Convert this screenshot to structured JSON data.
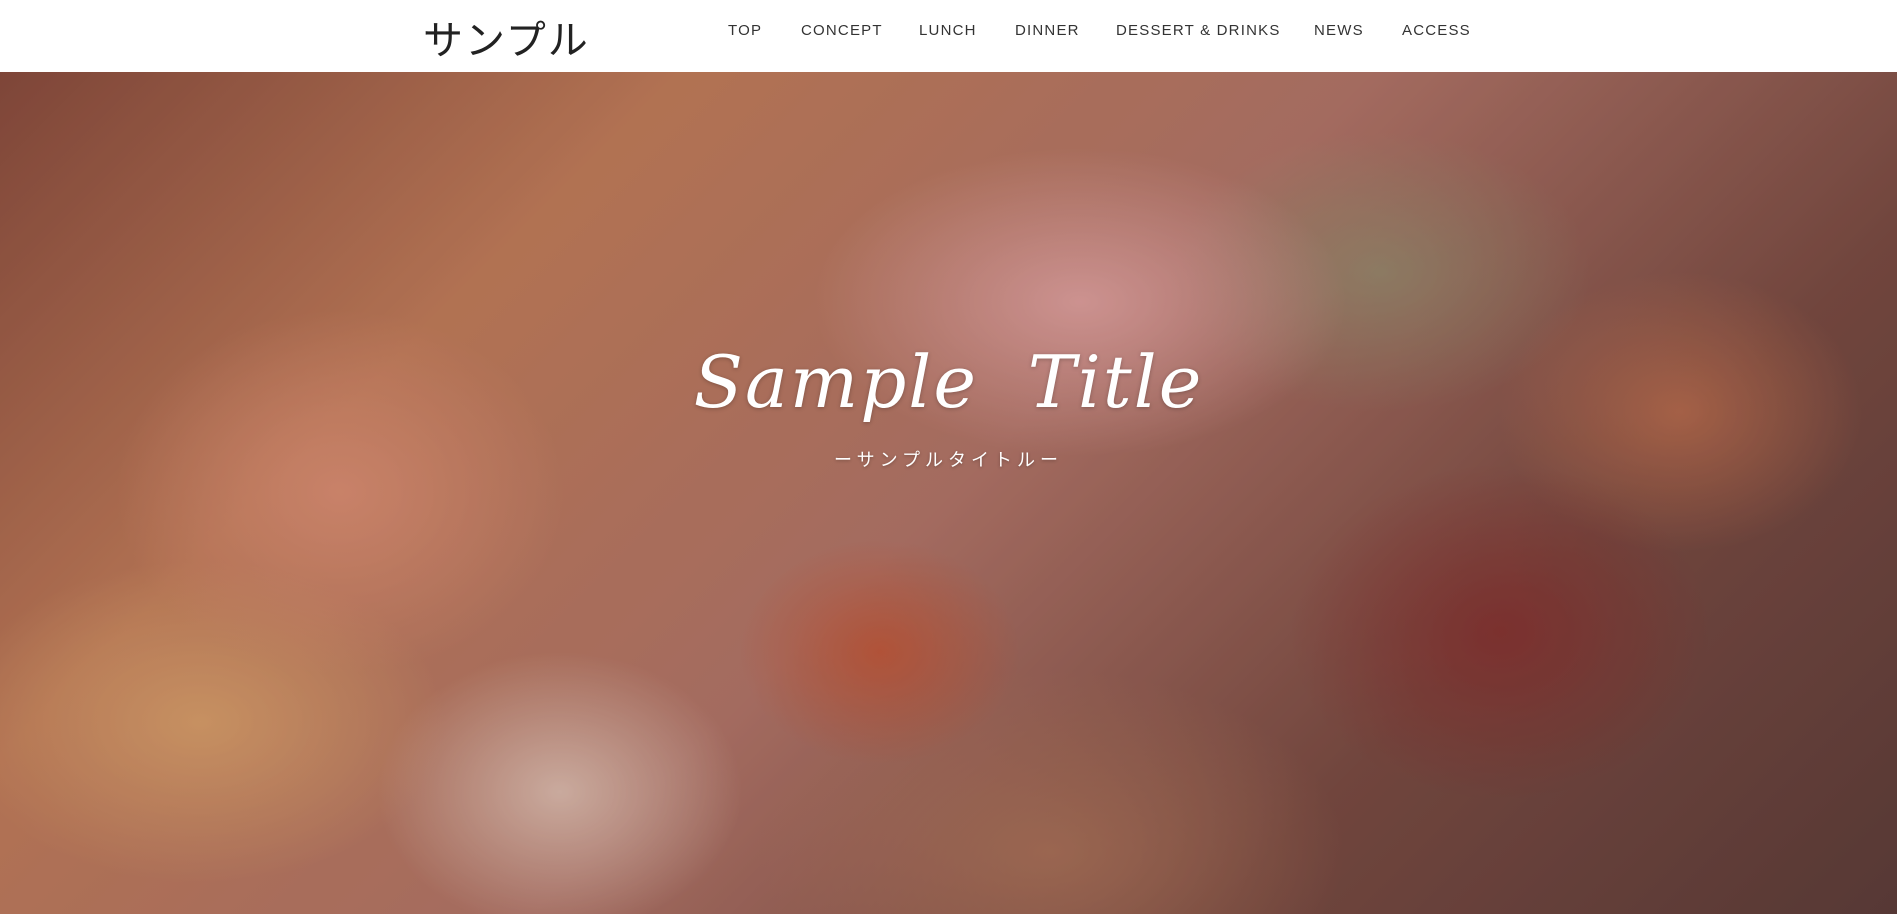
{
  "header": {
    "logo": "サンプル",
    "nav": [
      {
        "label": "TOP"
      },
      {
        "label": "CONCEPT"
      },
      {
        "label": "LUNCH"
      },
      {
        "label": "DINNER"
      },
      {
        "label": "DESSERT & DRINKS"
      },
      {
        "label": "NEWS"
      },
      {
        "label": "ACCESS"
      }
    ]
  },
  "hero": {
    "title": "Sample  Title",
    "subtitle": "ーサンプルタイトルー",
    "image_description": "photo-of-japanese-food-spread"
  },
  "colors": {
    "header_bg": "#ffffff",
    "nav_text": "#333333",
    "hero_text": "#ffffff"
  }
}
